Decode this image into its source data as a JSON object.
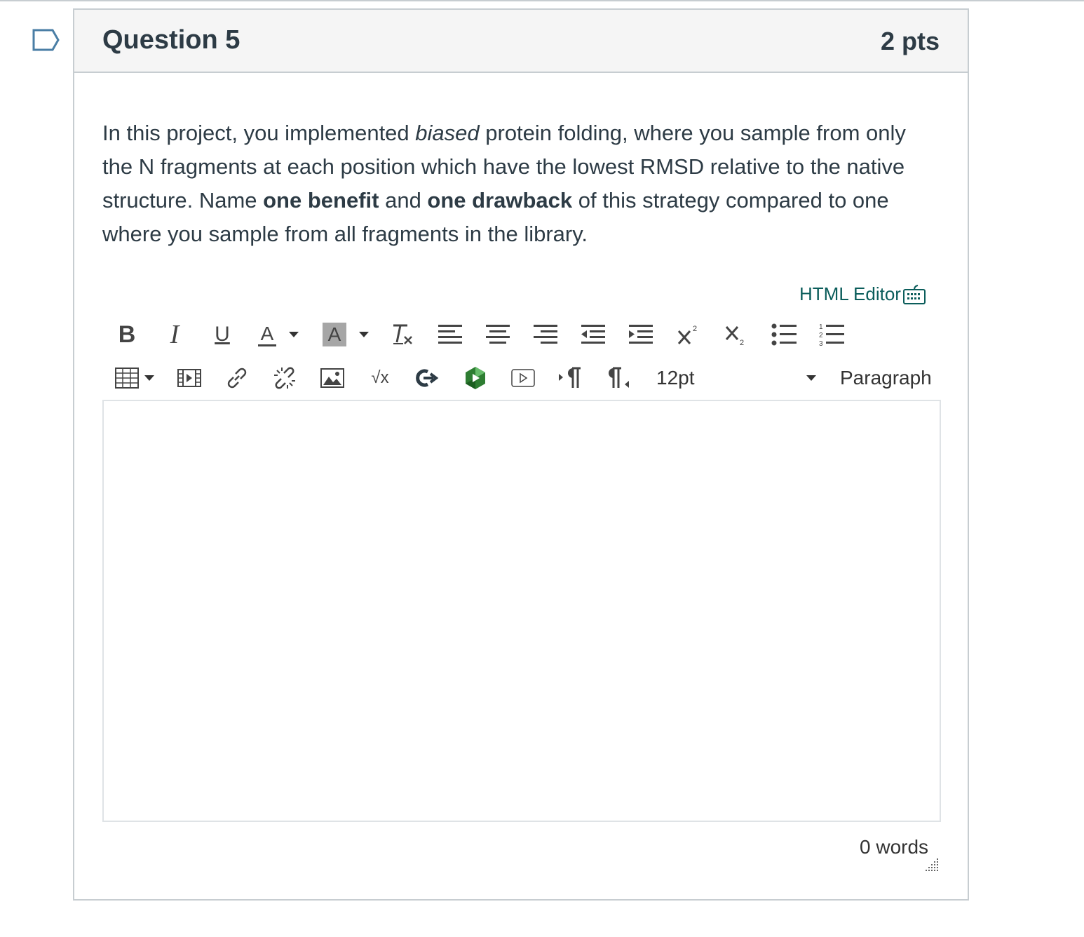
{
  "question": {
    "title": "Question 5",
    "points": "2 pts",
    "text": {
      "p1": "In this project, you implemented ",
      "em1": "biased",
      "p2": " protein folding, where you sample from only the N fragments at each position which have the lowest RMSD relative to the native structure. Name ",
      "strong1": "one benefit",
      "p3": " and ",
      "strong2": "one drawback",
      "p4": " of this strategy compared to one where you sample from all fragments in the library."
    }
  },
  "editor": {
    "html_editor_label": "HTML Editor",
    "font_size": "12pt",
    "block_format": "Paragraph",
    "word_count": "0 words",
    "bold_label": "B",
    "italic_label": "I",
    "underline_label": "U",
    "text_color_label": "A",
    "bg_color_label": "A",
    "sqrt_label": "√x",
    "toolbar_row1": [
      "bold",
      "italic",
      "underline",
      "text-color",
      "background-color",
      "clear-formatting",
      "align-left",
      "align-center",
      "align-right",
      "outdent",
      "indent",
      "superscript",
      "subscript",
      "bullet-list",
      "numbered-list"
    ],
    "toolbar_row2": [
      "table",
      "media",
      "link",
      "unlink",
      "image",
      "equation",
      "external-tools",
      "studio",
      "media-player",
      "ltr",
      "rtl",
      "font-size",
      "paragraph-format"
    ]
  },
  "colors": {
    "link": "#0b5d5b",
    "text": "#2d3b45",
    "border": "#c7cdd1",
    "header_bg": "#f5f5f5"
  }
}
